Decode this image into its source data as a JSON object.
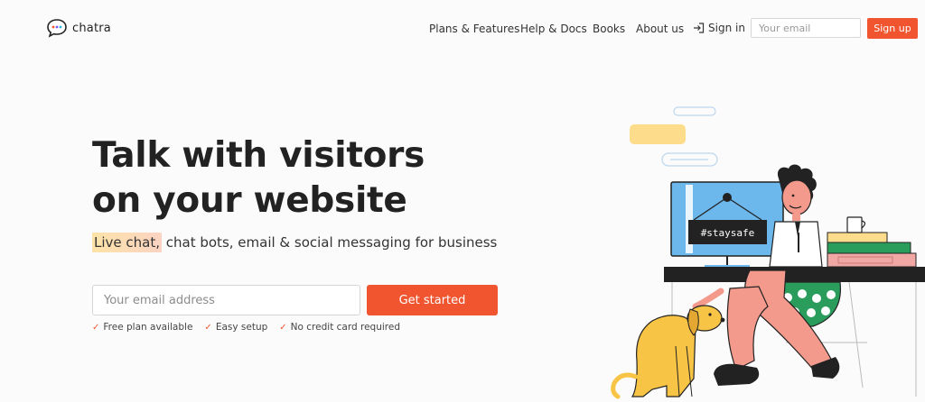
{
  "brand": {
    "name": "chatra",
    "accent_color": "#f0552f",
    "logo_icon": "chat-bubble-icon"
  },
  "nav": {
    "items": [
      "Plans & Features",
      "Help & Docs",
      "Books",
      "About us"
    ],
    "signin_label": "Sign in",
    "signin_icon": "sign-in-icon",
    "email_placeholder": "Your email",
    "signup_label": "Sign up"
  },
  "hero": {
    "headline_line1": "Talk with visitors",
    "headline_line2": "on your website",
    "sub_highlight": "Live chat,",
    "sub_rest": " chat bots, email & social messaging for business",
    "email_placeholder": "Your email address",
    "cta_label": "Get started",
    "features": [
      "Free plan available",
      "Easy setup",
      "No credit card required"
    ]
  },
  "illustration": {
    "sign_text": "#staysafe"
  }
}
